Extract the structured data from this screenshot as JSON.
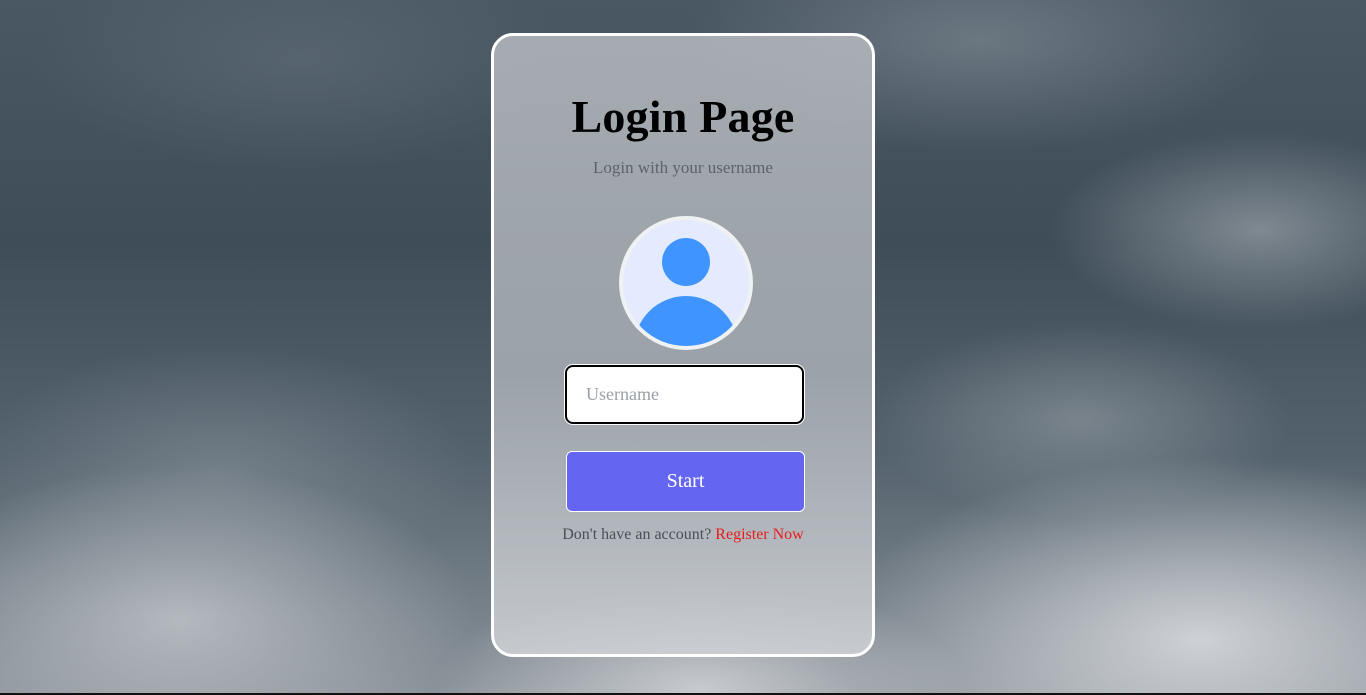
{
  "login_card": {
    "title": "Login Page",
    "subtitle": "Login with your username",
    "avatar_icon": "user-avatar-icon",
    "username_field": {
      "placeholder": "Username",
      "value": ""
    },
    "start_label": "Start",
    "register_prompt": "Don't have an account?",
    "register_link": "Register Now"
  },
  "colors": {
    "accent": "#6466f1",
    "link": "#e81d1d",
    "avatar_fill": "#3f94ff",
    "avatar_bg": "#e4ebff"
  }
}
